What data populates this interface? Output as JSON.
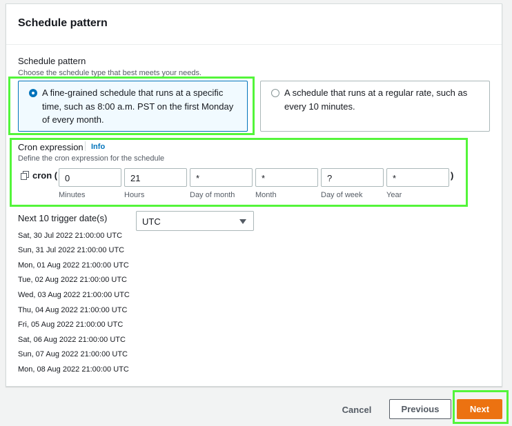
{
  "panel": {
    "title": "Schedule pattern"
  },
  "schedule_pattern": {
    "label": "Schedule pattern",
    "description": "Choose the schedule type that best meets your needs.",
    "options": [
      {
        "lines": [
          "A fine-grained schedule that runs at a specific",
          "time, such as 8:00 a.m. PST on the first Monday",
          "of every month."
        ],
        "selected": true
      },
      {
        "lines": [
          "A schedule that runs at a regular rate, such as",
          "every 10 minutes."
        ],
        "selected": false
      }
    ]
  },
  "cron": {
    "label": "Cron expression",
    "info_link": "Info",
    "description": "Define the cron expression for the schedule",
    "prefix": "cron (",
    "suffix": ")",
    "fields": [
      {
        "value": "0",
        "caption": "Minutes"
      },
      {
        "value": "21",
        "caption": "Hours"
      },
      {
        "value": "*",
        "caption": "Day of month"
      },
      {
        "value": "*",
        "caption": "Month"
      },
      {
        "value": "?",
        "caption": "Day of week"
      },
      {
        "value": "*",
        "caption": "Year"
      }
    ]
  },
  "trigger": {
    "label": "Next 10 trigger date(s)",
    "timezone": "UTC",
    "dates": [
      "Sat, 30 Jul 2022 21:00:00 UTC",
      "Sun, 31 Jul 2022 21:00:00 UTC",
      "Mon, 01 Aug 2022 21:00:00 UTC",
      "Tue, 02 Aug 2022 21:00:00 UTC",
      "Wed, 03 Aug 2022 21:00:00 UTC",
      "Thu, 04 Aug 2022 21:00:00 UTC",
      "Fri, 05 Aug 2022 21:00:00 UTC",
      "Sat, 06 Aug 2022 21:00:00 UTC",
      "Sun, 07 Aug 2022 21:00:00 UTC",
      "Mon, 08 Aug 2022 21:00:00 UTC"
    ]
  },
  "footer": {
    "cancel": "Cancel",
    "previous": "Previous",
    "next": "Next"
  },
  "colors": {
    "accent": "#0073bb",
    "primary": "#ec7211",
    "highlight": "#53f53a"
  }
}
